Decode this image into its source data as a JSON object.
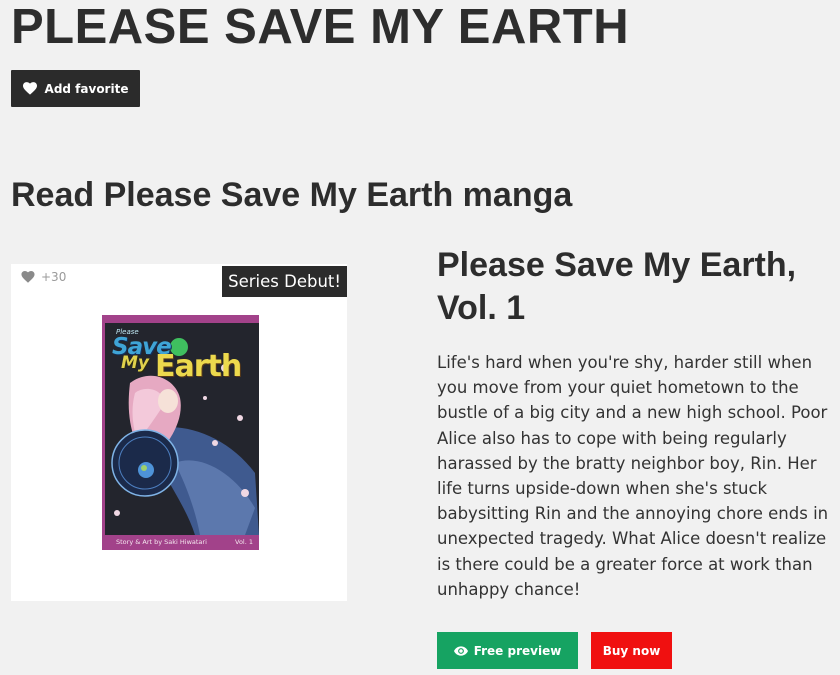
{
  "header": {
    "title": "PLEASE SAVE MY EARTH",
    "favorite_label": "Add favorite",
    "favorite_icon": "heart-icon"
  },
  "section": {
    "heading": "Read Please Save My Earth manga"
  },
  "volume": {
    "like_count": "+30",
    "like_icon": "heart-icon",
    "badge": "Series Debut!",
    "cover": {
      "logo_please": "Please",
      "logo_save": "Save",
      "logo_my": "My",
      "logo_earth": "Earth",
      "credit": "Story & Art by Saki Hiwatari",
      "volume_label": "Vol. 1",
      "accent_color": "#a2428a"
    },
    "title": "Please Save My Earth, Vol. 1",
    "description": "Life's hard when you're shy, harder still when you move from your quiet hometown to the bustle of a big city and a new high school. Poor Alice also has to cope with being regularly harassed by the bratty neighbor boy, Rin. Her life turns upside-down when she's stuck babysitting Rin and the annoying chore ends in unexpected tragedy. What Alice doesn't realize is there could be a greater force at work than unhappy chance!",
    "preview_label": "Free preview",
    "preview_icon": "eye-icon",
    "buy_label": "Buy now"
  },
  "colors": {
    "background": "#f1f1f1",
    "dark_button": "#2b2b2b",
    "preview_button": "#16a362",
    "buy_button": "#f01010"
  }
}
